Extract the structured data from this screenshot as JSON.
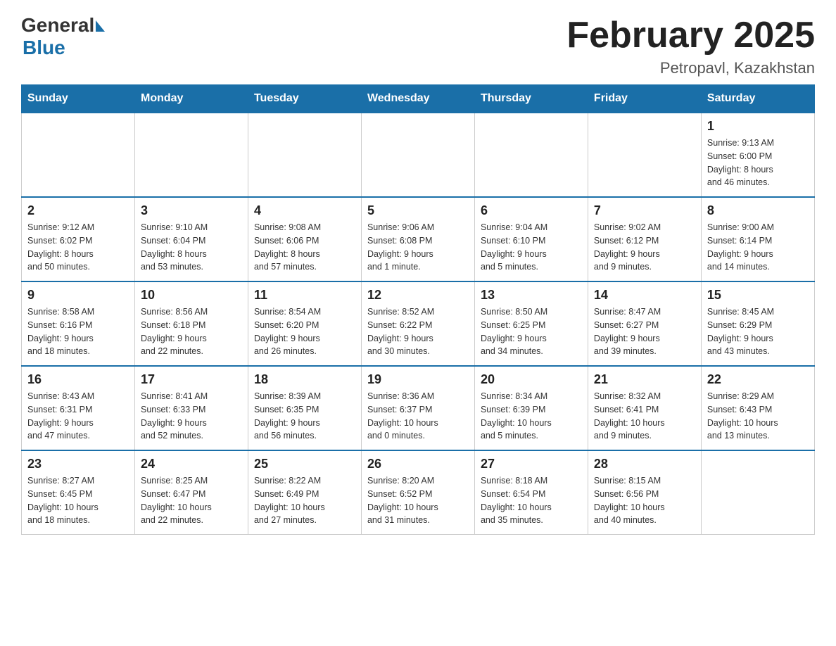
{
  "header": {
    "logo_general": "General",
    "logo_blue": "Blue",
    "title": "February 2025",
    "subtitle": "Petropavl, Kazakhstan"
  },
  "weekdays": [
    "Sunday",
    "Monday",
    "Tuesday",
    "Wednesday",
    "Thursday",
    "Friday",
    "Saturday"
  ],
  "weeks": [
    [
      {
        "day": "",
        "info": ""
      },
      {
        "day": "",
        "info": ""
      },
      {
        "day": "",
        "info": ""
      },
      {
        "day": "",
        "info": ""
      },
      {
        "day": "",
        "info": ""
      },
      {
        "day": "",
        "info": ""
      },
      {
        "day": "1",
        "info": "Sunrise: 9:13 AM\nSunset: 6:00 PM\nDaylight: 8 hours\nand 46 minutes."
      }
    ],
    [
      {
        "day": "2",
        "info": "Sunrise: 9:12 AM\nSunset: 6:02 PM\nDaylight: 8 hours\nand 50 minutes."
      },
      {
        "day": "3",
        "info": "Sunrise: 9:10 AM\nSunset: 6:04 PM\nDaylight: 8 hours\nand 53 minutes."
      },
      {
        "day": "4",
        "info": "Sunrise: 9:08 AM\nSunset: 6:06 PM\nDaylight: 8 hours\nand 57 minutes."
      },
      {
        "day": "5",
        "info": "Sunrise: 9:06 AM\nSunset: 6:08 PM\nDaylight: 9 hours\nand 1 minute."
      },
      {
        "day": "6",
        "info": "Sunrise: 9:04 AM\nSunset: 6:10 PM\nDaylight: 9 hours\nand 5 minutes."
      },
      {
        "day": "7",
        "info": "Sunrise: 9:02 AM\nSunset: 6:12 PM\nDaylight: 9 hours\nand 9 minutes."
      },
      {
        "day": "8",
        "info": "Sunrise: 9:00 AM\nSunset: 6:14 PM\nDaylight: 9 hours\nand 14 minutes."
      }
    ],
    [
      {
        "day": "9",
        "info": "Sunrise: 8:58 AM\nSunset: 6:16 PM\nDaylight: 9 hours\nand 18 minutes."
      },
      {
        "day": "10",
        "info": "Sunrise: 8:56 AM\nSunset: 6:18 PM\nDaylight: 9 hours\nand 22 minutes."
      },
      {
        "day": "11",
        "info": "Sunrise: 8:54 AM\nSunset: 6:20 PM\nDaylight: 9 hours\nand 26 minutes."
      },
      {
        "day": "12",
        "info": "Sunrise: 8:52 AM\nSunset: 6:22 PM\nDaylight: 9 hours\nand 30 minutes."
      },
      {
        "day": "13",
        "info": "Sunrise: 8:50 AM\nSunset: 6:25 PM\nDaylight: 9 hours\nand 34 minutes."
      },
      {
        "day": "14",
        "info": "Sunrise: 8:47 AM\nSunset: 6:27 PM\nDaylight: 9 hours\nand 39 minutes."
      },
      {
        "day": "15",
        "info": "Sunrise: 8:45 AM\nSunset: 6:29 PM\nDaylight: 9 hours\nand 43 minutes."
      }
    ],
    [
      {
        "day": "16",
        "info": "Sunrise: 8:43 AM\nSunset: 6:31 PM\nDaylight: 9 hours\nand 47 minutes."
      },
      {
        "day": "17",
        "info": "Sunrise: 8:41 AM\nSunset: 6:33 PM\nDaylight: 9 hours\nand 52 minutes."
      },
      {
        "day": "18",
        "info": "Sunrise: 8:39 AM\nSunset: 6:35 PM\nDaylight: 9 hours\nand 56 minutes."
      },
      {
        "day": "19",
        "info": "Sunrise: 8:36 AM\nSunset: 6:37 PM\nDaylight: 10 hours\nand 0 minutes."
      },
      {
        "day": "20",
        "info": "Sunrise: 8:34 AM\nSunset: 6:39 PM\nDaylight: 10 hours\nand 5 minutes."
      },
      {
        "day": "21",
        "info": "Sunrise: 8:32 AM\nSunset: 6:41 PM\nDaylight: 10 hours\nand 9 minutes."
      },
      {
        "day": "22",
        "info": "Sunrise: 8:29 AM\nSunset: 6:43 PM\nDaylight: 10 hours\nand 13 minutes."
      }
    ],
    [
      {
        "day": "23",
        "info": "Sunrise: 8:27 AM\nSunset: 6:45 PM\nDaylight: 10 hours\nand 18 minutes."
      },
      {
        "day": "24",
        "info": "Sunrise: 8:25 AM\nSunset: 6:47 PM\nDaylight: 10 hours\nand 22 minutes."
      },
      {
        "day": "25",
        "info": "Sunrise: 8:22 AM\nSunset: 6:49 PM\nDaylight: 10 hours\nand 27 minutes."
      },
      {
        "day": "26",
        "info": "Sunrise: 8:20 AM\nSunset: 6:52 PM\nDaylight: 10 hours\nand 31 minutes."
      },
      {
        "day": "27",
        "info": "Sunrise: 8:18 AM\nSunset: 6:54 PM\nDaylight: 10 hours\nand 35 minutes."
      },
      {
        "day": "28",
        "info": "Sunrise: 8:15 AM\nSunset: 6:56 PM\nDaylight: 10 hours\nand 40 minutes."
      },
      {
        "day": "",
        "info": ""
      }
    ]
  ]
}
